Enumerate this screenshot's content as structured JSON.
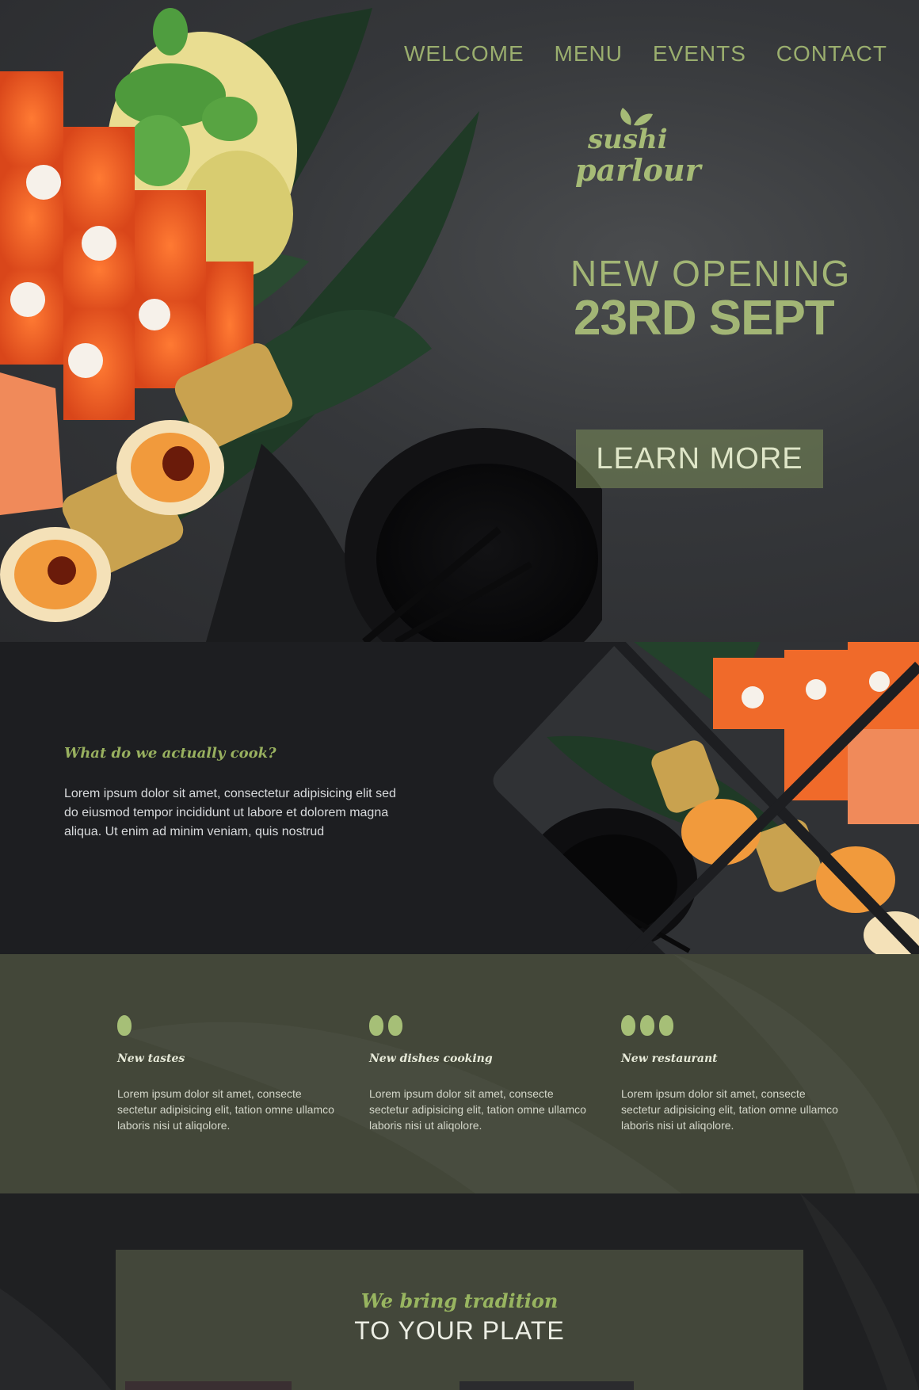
{
  "nav": {
    "items": [
      {
        "label": "WELCOME"
      },
      {
        "label": "MENU"
      },
      {
        "label": "EVENTS"
      },
      {
        "label": "CONTACT"
      }
    ]
  },
  "logo": {
    "line1": "sushi",
    "line2": "parlour"
  },
  "hero": {
    "line1": "NEW OPENING",
    "line2": "23RD SEPT",
    "cta_label": "LEARN MORE"
  },
  "about": {
    "title": "What do we actually cook?",
    "text": "Lorem ipsum dolor sit amet, consectetur adipisicing elit sed do eiusmod tempor incididunt ut labore et dolorem magna aliqua. Ut enim ad minim veniam, quis nostrud"
  },
  "features": [
    {
      "title": "New tastes",
      "text": "Lorem ipsum dolor sit amet, consecte sectetur adipisicing elit, tation omne ullamco laboris nisi ut aliqolore.",
      "count": 1
    },
    {
      "title": "New dishes cooking",
      "text": "Lorem ipsum dolor sit amet, consecte sectetur adipisicing elit, tation omne ullamco laboris nisi ut aliqolore.",
      "count": 2
    },
    {
      "title": "New restaurant",
      "text": "Lorem ipsum dolor sit amet, consecte sectetur adipisicing elit, tation omne ullamco laboris nisi ut aliqolore.",
      "count": 3
    }
  ],
  "tradition": {
    "subtitle": "We bring tradition",
    "title": "TO YOUR PLATE"
  },
  "colors": {
    "accent": "#a2b575",
    "feature_bg": "#434739",
    "dark_bg": "#1e1f21",
    "salmon": "#f06a2a"
  }
}
